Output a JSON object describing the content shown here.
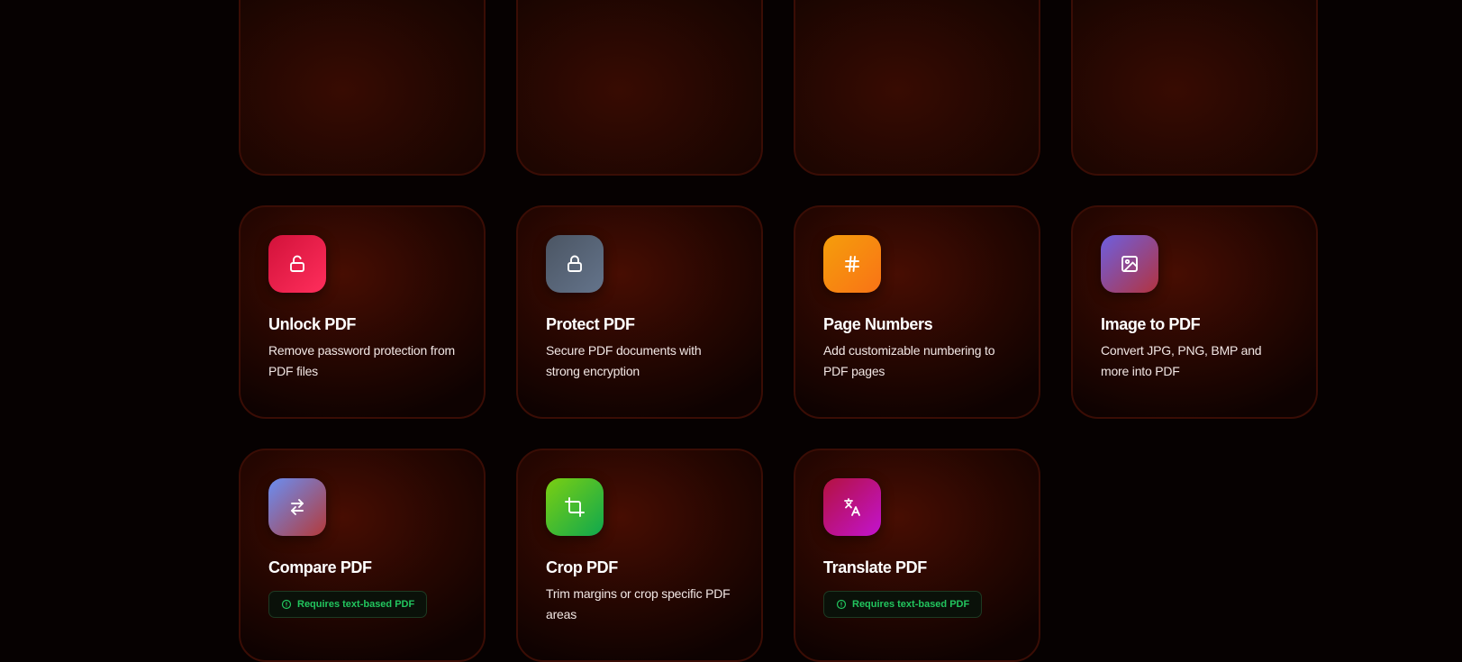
{
  "tools": [
    {
      "key": "unlock",
      "title": "Unlock PDF",
      "description": "Remove password protection from PDF files",
      "icon": "unlock-icon",
      "gradient": [
        "#d2123a",
        "#ff2e5c"
      ]
    },
    {
      "key": "protect",
      "title": "Protect PDF",
      "description": "Secure PDF documents with strong encryption",
      "icon": "lock-icon",
      "gradient": [
        "#4b5563",
        "#64748b"
      ]
    },
    {
      "key": "page-numbers",
      "title": "Page Numbers",
      "description": "Add customizable numbering to PDF pages",
      "icon": "hash-icon",
      "gradient": [
        "#f59e0b",
        "#f97316"
      ]
    },
    {
      "key": "image-to-pdf",
      "title": "Image to PDF",
      "description": "Convert JPG, PNG, BMP and more into PDF",
      "icon": "image-icon",
      "gradient": [
        "#6d5fe0",
        "#b3333f"
      ]
    },
    {
      "key": "compare",
      "title": "Compare PDF",
      "badge": "Requires text-based PDF",
      "icon": "arrows-left-right-icon",
      "gradient": [
        "#6a8ef2",
        "#b43a3a"
      ]
    },
    {
      "key": "crop",
      "title": "Crop PDF",
      "description": "Trim margins or crop specific PDF areas",
      "icon": "crop-icon",
      "gradient": [
        "#7bcf12",
        "#0fa84e"
      ]
    },
    {
      "key": "translate",
      "title": "Translate PDF",
      "badge": "Requires text-based PDF",
      "icon": "translate-icon",
      "gradient": [
        "#b4123f",
        "#c213cf"
      ]
    }
  ],
  "colors": {
    "badge_text": "#22c55e",
    "page_background": "#060101"
  }
}
